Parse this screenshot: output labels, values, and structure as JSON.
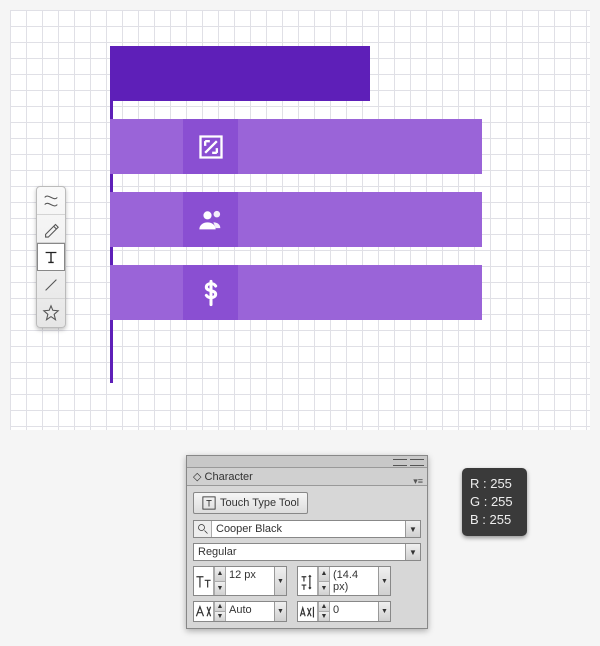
{
  "artboard": {
    "row_icons": [
      "expand-icon",
      "users-icon",
      "dollar-icon"
    ]
  },
  "toolbar": {
    "tools": [
      "warp-tool",
      "pen-tool",
      "type-tool",
      "line-tool",
      "star-tool"
    ],
    "selected": "type-tool"
  },
  "character_panel": {
    "title": "Character",
    "touch_type_label": "Touch Type Tool",
    "font_family": "Cooper Black",
    "font_style": "Regular",
    "font_size": "12 px",
    "leading": "(14.4 px)",
    "kerning": "Auto",
    "tracking": "0"
  },
  "rgb": {
    "r": "R : 255",
    "g": "G : 255",
    "b": "B : 255"
  }
}
